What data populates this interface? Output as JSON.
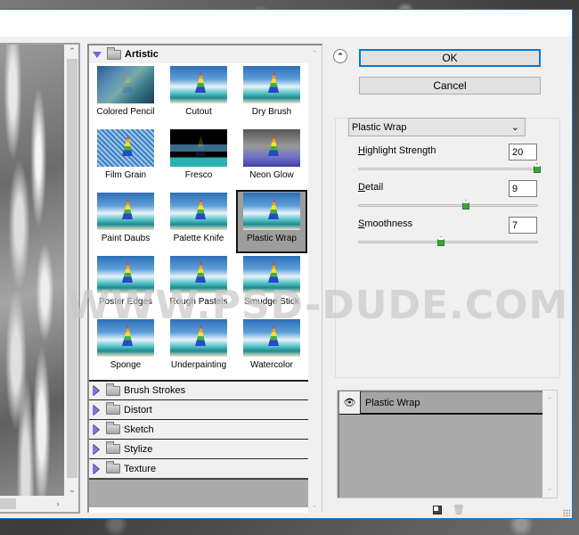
{
  "dialog": {
    "buttons": {
      "ok": "OK",
      "cancel": "Cancel"
    },
    "collapse_icon": "double-chevron-up-icon"
  },
  "gallery": {
    "open_category": "Artistic",
    "filters": [
      {
        "label": "Colored Pencil",
        "selected": false
      },
      {
        "label": "Cutout",
        "selected": false
      },
      {
        "label": "Dry Brush",
        "selected": false
      },
      {
        "label": "Film Grain",
        "selected": false
      },
      {
        "label": "Fresco",
        "selected": false
      },
      {
        "label": "Neon Glow",
        "selected": false
      },
      {
        "label": "Paint Daubs",
        "selected": false
      },
      {
        "label": "Palette Knife",
        "selected": false
      },
      {
        "label": "Plastic Wrap",
        "selected": true
      },
      {
        "label": "Poster Edges",
        "selected": false
      },
      {
        "label": "Rough Pastels",
        "selected": false
      },
      {
        "label": "Smudge Stick",
        "selected": false
      },
      {
        "label": "Sponge",
        "selected": false
      },
      {
        "label": "Underpainting",
        "selected": false
      },
      {
        "label": "Watercolor",
        "selected": false
      }
    ],
    "collapsed_categories": [
      "Brush Strokes",
      "Distort",
      "Sketch",
      "Stylize",
      "Texture"
    ]
  },
  "settings": {
    "filter_select": "Plastic Wrap",
    "params": [
      {
        "label_u": "H",
        "label_rest": "ighlight Strength",
        "value": "20",
        "slider_fraction": 1.0
      },
      {
        "label_u": "D",
        "label_rest": "etail",
        "value": "9",
        "slider_fraction": 0.6
      },
      {
        "label_u": "S",
        "label_rest": "moothness",
        "value": "7",
        "slider_fraction": 0.46
      }
    ]
  },
  "layers": {
    "items": [
      {
        "name": "Plastic Wrap",
        "visible": true
      }
    ]
  },
  "watermark": "WWW.PSD-DUDE.COM",
  "colors": {
    "accent": "#0078d7",
    "selected_cell": "#9d9d9d",
    "category_triangle": "#7878e8",
    "slider_knob": "#3ca33c"
  }
}
